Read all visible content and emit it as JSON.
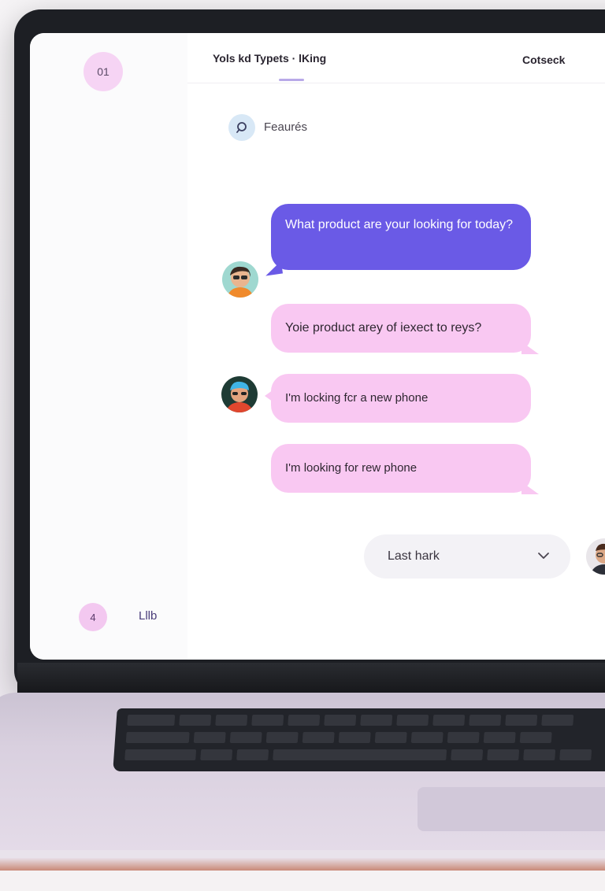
{
  "sidebar": {
    "top_badge": "01",
    "bottom_badge": "4",
    "bottom_label": "Lllb"
  },
  "header": {
    "title": "Yols kd Typets · lKing",
    "right_label": "Cotseck"
  },
  "features": {
    "icon": "search-icon",
    "label": "Feaurés"
  },
  "chat": {
    "messages": [
      {
        "text": "What product are your looking for today?",
        "style": "purple"
      },
      {
        "text": "Yoie product arey of iexect to reys?",
        "style": "pink"
      },
      {
        "text": "I'm locking fcr a new phone",
        "style": "pink"
      },
      {
        "text": "I'm looking for rew phone",
        "style": "pink"
      }
    ]
  },
  "dropdown": {
    "selected": "Last hark",
    "icon": "chevron-down-icon"
  },
  "colors": {
    "accent_purple": "#6a5ae6",
    "bubble_pink": "#f9c8f2",
    "badge_pink": "#f6d4f4"
  }
}
